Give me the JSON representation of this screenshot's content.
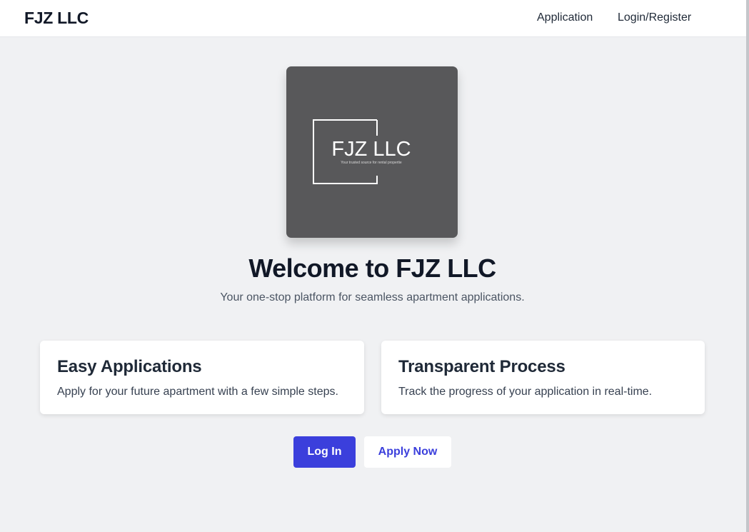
{
  "nav": {
    "brand": "FJZ LLC",
    "links": [
      "Application",
      "Login/Register"
    ]
  },
  "logo": {
    "name": "FJZ LLC",
    "tagline": "Your trusted source for rental propertie"
  },
  "hero": {
    "title": "Welcome to FJZ LLC",
    "subtitle": "Your one-stop platform for seamless apartment applications."
  },
  "features": [
    {
      "title": "Easy Applications",
      "text": "Apply for your future apartment with a few simple steps."
    },
    {
      "title": "Transparent Process",
      "text": "Track the progress of your application in real-time."
    }
  ],
  "actions": {
    "login_label": "Log In",
    "apply_label": "Apply Now"
  },
  "colors": {
    "primary": "#3b3fdc",
    "background": "#f0f1f3",
    "logo_background": "#58585a"
  }
}
